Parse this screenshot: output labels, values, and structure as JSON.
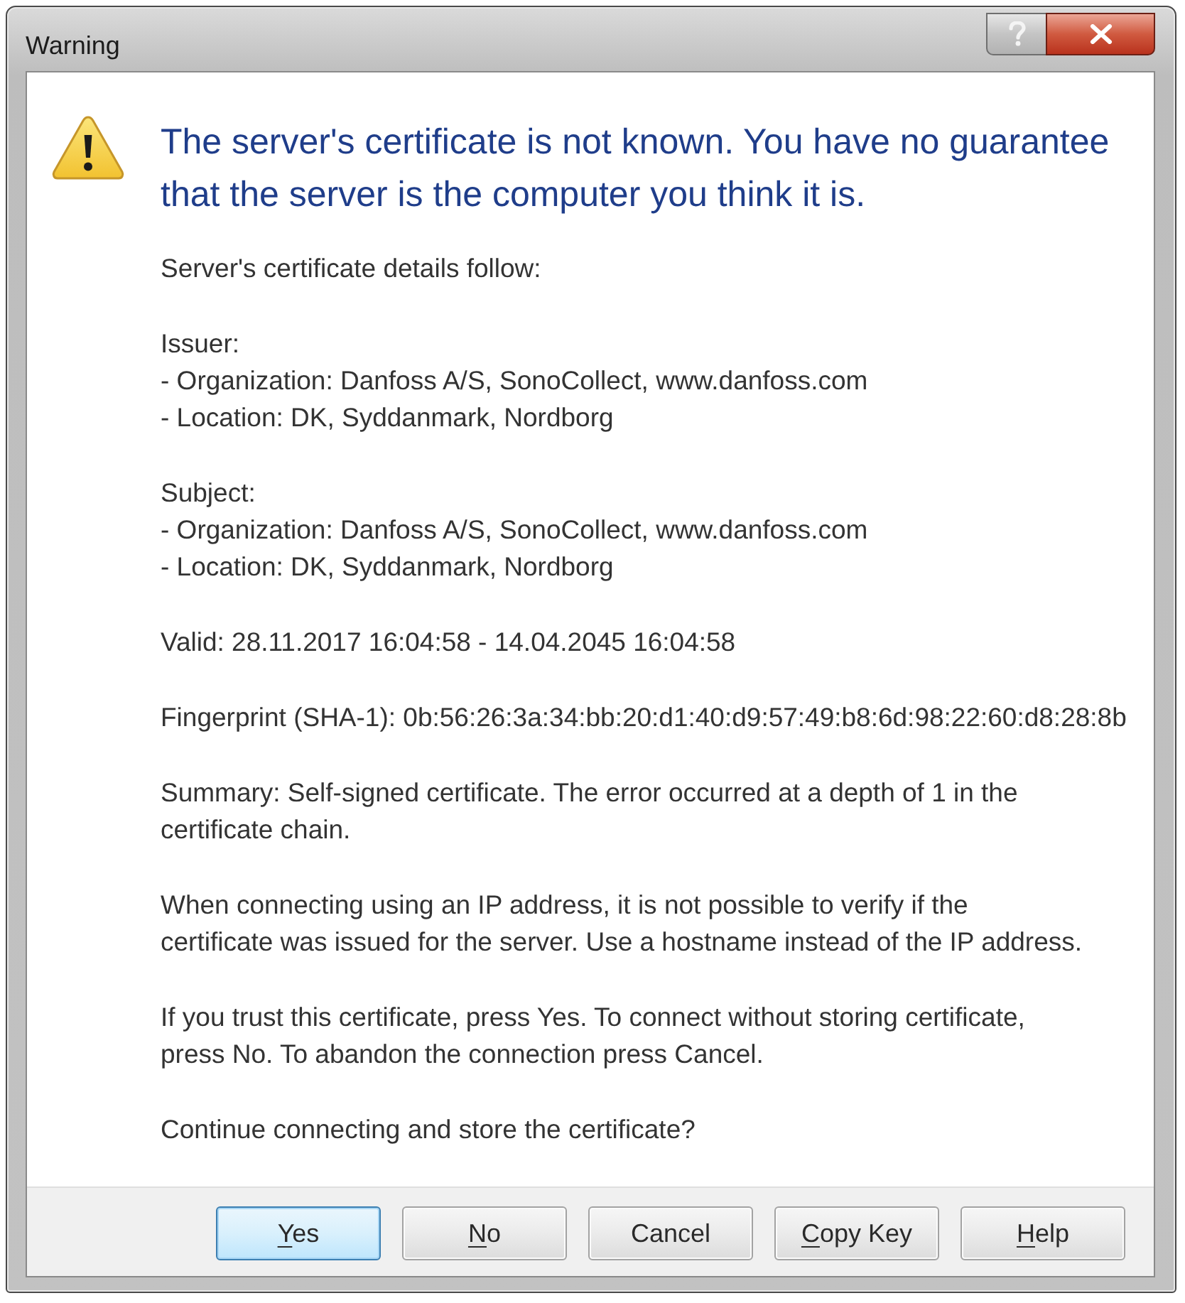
{
  "window": {
    "title": "Warning"
  },
  "heading": "The server's certificate is not known. You have no guarantee that the server is the computer you think it is.",
  "paragraphs": [
    {
      "lines": [
        "Server's certificate details follow:"
      ]
    },
    {
      "lines": [
        "Issuer:",
        "- Organization: Danfoss A/S, SonoCollect, www.danfoss.com",
        "- Location: DK, Syddanmark, Nordborg"
      ]
    },
    {
      "lines": [
        "Subject:",
        "- Organization: Danfoss A/S, SonoCollect, www.danfoss.com",
        "- Location: DK, Syddanmark, Nordborg"
      ]
    },
    {
      "lines": [
        "Valid: 28.11.2017 16:04:58 - 14.04.2045 16:04:58"
      ]
    },
    {
      "lines": [
        "Fingerprint (SHA-1): 0b:56:26:3a:34:bb:20:d1:40:d9:57:49:b8:6d:98:22:60:d8:28:8b"
      ]
    },
    {
      "lines": [
        "Summary: Self-signed certificate. The error occurred at a depth of 1 in the",
        "certificate chain."
      ]
    },
    {
      "lines": [
        "When connecting using an IP address, it is not possible to verify if the",
        "certificate was issued for the server. Use a hostname instead of the IP address."
      ]
    },
    {
      "lines": [
        "If you trust this certificate, press Yes. To connect without storing certificate,",
        "press No. To abandon the connection press Cancel."
      ]
    },
    {
      "lines": [
        "Continue connecting and store the certificate?"
      ]
    }
  ],
  "buttons": [
    {
      "label": "Yes",
      "mnemonic": true,
      "default": true
    },
    {
      "label": "No",
      "mnemonic": true,
      "default": false
    },
    {
      "label": "Cancel",
      "mnemonic": false,
      "default": false
    },
    {
      "label": "Copy Key",
      "mnemonic": true,
      "default": false
    },
    {
      "label": "Help",
      "mnemonic": true,
      "default": false
    }
  ]
}
